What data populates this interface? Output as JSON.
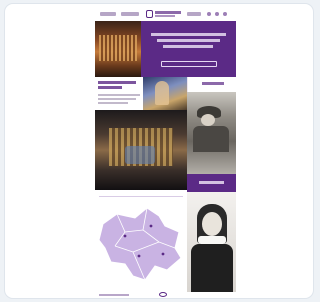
{
  "colors": {
    "page_background": "#eef2f6",
    "brand_purple": "#5b2a86",
    "map_fill": "#c9b3e3"
  },
  "icons": {
    "logo": "logo-icon",
    "search": "search-icon",
    "account": "user-icon",
    "menu": "menu-icon",
    "footer_logo": "footer-logo-icon"
  }
}
